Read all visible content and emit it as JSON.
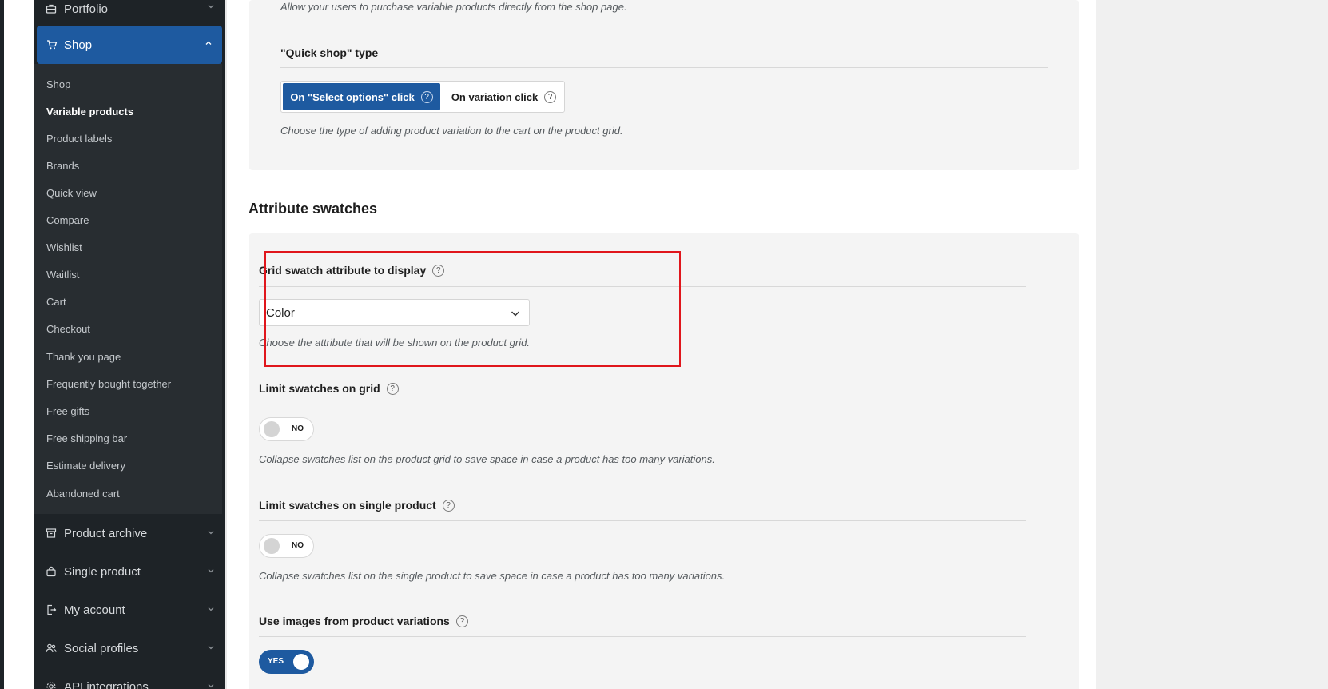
{
  "sidebar": {
    "top_item": {
      "label": "Portfolio",
      "icon": "briefcase-icon"
    },
    "shop": {
      "label": "Shop",
      "icon": "cart-icon"
    },
    "submenu": [
      {
        "label": "Shop",
        "active": false
      },
      {
        "label": "Variable products",
        "active": true
      },
      {
        "label": "Product labels",
        "active": false
      },
      {
        "label": "Brands",
        "active": false
      },
      {
        "label": "Quick view",
        "active": false
      },
      {
        "label": "Compare",
        "active": false
      },
      {
        "label": "Wishlist",
        "active": false
      },
      {
        "label": "Waitlist",
        "active": false
      },
      {
        "label": "Cart",
        "active": false
      },
      {
        "label": "Checkout",
        "active": false
      },
      {
        "label": "Thank you page",
        "active": false
      },
      {
        "label": "Frequently bought together",
        "active": false
      },
      {
        "label": "Free gifts",
        "active": false
      },
      {
        "label": "Free shipping bar",
        "active": false
      },
      {
        "label": "Estimate delivery",
        "active": false
      },
      {
        "label": "Abandoned cart",
        "active": false
      }
    ],
    "items": [
      {
        "label": "Product archive",
        "icon": "archive-icon"
      },
      {
        "label": "Single product",
        "icon": "bag-icon"
      },
      {
        "label": "My account",
        "icon": "account-icon"
      },
      {
        "label": "Social profiles",
        "icon": "users-icon"
      },
      {
        "label": "API integrations",
        "icon": "gear-icon"
      }
    ]
  },
  "main": {
    "quick_shop_desc": "Allow your users to purchase variable products directly from the shop page.",
    "quick_shop_type": {
      "title": "\"Quick shop\" type",
      "options": [
        "On \"Select options\" click",
        "On variation click"
      ],
      "selected": "On \"Select options\" click",
      "desc": "Choose the type of adding product variation to the cart on the product grid."
    },
    "attribute_swatches": {
      "title": "Attribute swatches",
      "grid_swatch": {
        "title": "Grid swatch attribute to display",
        "value": "Color",
        "desc": "Choose the attribute that will be shown on the product grid."
      },
      "limit_grid": {
        "title": "Limit swatches on grid",
        "toggle": "NO",
        "desc": "Collapse swatches list on the product grid to save space in case a product has too many variations."
      },
      "limit_single": {
        "title": "Limit swatches on single product",
        "toggle": "NO",
        "desc": "Collapse swatches list on the single product to save space in case a product has too many variations."
      },
      "use_images": {
        "title": "Use images from product variations",
        "toggle": "YES"
      }
    }
  },
  "colors": {
    "accent": "#1e5aa0",
    "sidebar": "#1e2327",
    "highlight": "#e0161c"
  }
}
